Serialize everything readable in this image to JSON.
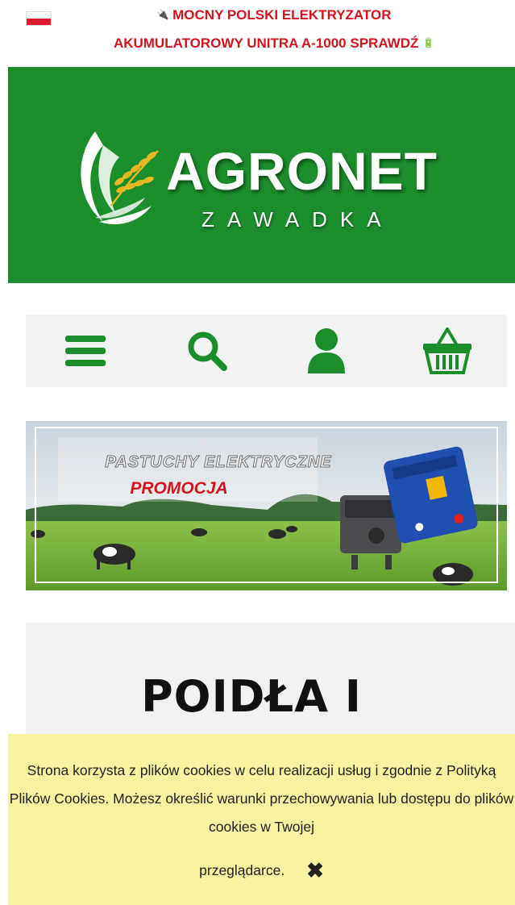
{
  "top_promo": {
    "line1": "MOCNY POLSKI ELEKTRYZATOR",
    "line2": "AKUMULATOROWY UNITRA A-1000 SPRAWDŹ",
    "left_emoji": "🔌",
    "right_emoji": "🔋",
    "color": "#d2141e"
  },
  "brand": {
    "name": "AGRONET",
    "location": "ZAWADKA",
    "bg_color": "#1b8e2b"
  },
  "nav": {
    "menu_icon": "hamburger-icon",
    "search_icon": "search-icon",
    "account_icon": "user-icon",
    "cart_icon": "basket-icon",
    "accent": "#1b8e2b"
  },
  "banner": {
    "title": "PASTUCHY ELEKTRYCZNE",
    "promo": "PROMOCJA"
  },
  "content": {
    "title": "POIDŁA I"
  },
  "cookie": {
    "text": "Strona korzysta z plików cookies w celu realizacji usług i zgodnie z Polityką Plików Cookies. Możesz określić warunki przechowywania lub dostępu do plików cookies w Twojej",
    "last_word": "przeglądarce.",
    "close_icon": "close-icon"
  }
}
